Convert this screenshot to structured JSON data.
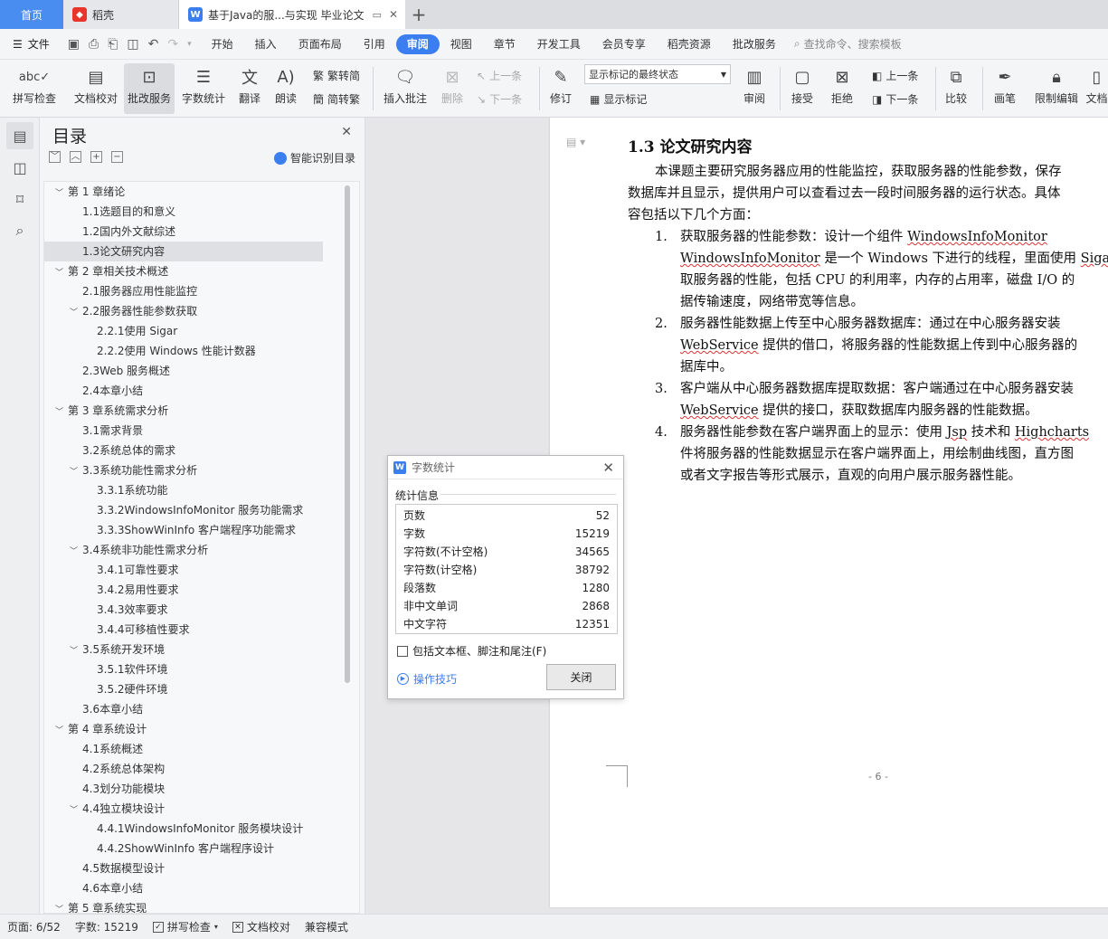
{
  "tabs": [
    {
      "label": "首页"
    },
    {
      "label": "稻壳"
    },
    {
      "label": "基于Java的服...与实现 毕业论文"
    }
  ],
  "menu": {
    "file": "文件",
    "items": [
      "开始",
      "插入",
      "页面布局",
      "引用",
      "审阅",
      "视图",
      "章节",
      "开发工具",
      "会员专享",
      "稻壳资源",
      "批改服务"
    ],
    "active_index": 4,
    "search": "查找命令、搜索模板"
  },
  "ribbon": {
    "spell": "拼写检查",
    "proof": "文档校对",
    "correct": "批改服务",
    "wordcount": "字数统计",
    "translate": "翻译",
    "read": "朗读",
    "trad": "繁转简",
    "simp": "简转繁",
    "insert_comment": "插入批注",
    "delete": "删除",
    "prev": "上一条",
    "next": "下一条",
    "revise": "修订",
    "markup_state": "显示标记的最终状态",
    "show_markup": "显示标记",
    "review": "审阅",
    "accept": "接受",
    "reject": "拒绝",
    "prev2": "上一条",
    "next2": "下一条",
    "compare": "比较",
    "pen": "画笔",
    "restrict": "限制编辑",
    "doc": "文档"
  },
  "toc": {
    "title": "目录",
    "smart": "智能识别目录",
    "items": [
      {
        "label": "第 1 章绪论",
        "level": 1,
        "arrow": "﹀"
      },
      {
        "label": "1.1选题目的和意义",
        "level": 2,
        "arrow": ""
      },
      {
        "label": "1.2国内外文献综述",
        "level": 2,
        "arrow": ""
      },
      {
        "label": "1.3论文研究内容",
        "level": 2,
        "arrow": "",
        "selected": true
      },
      {
        "label": "第 2 章相关技术概述",
        "level": 1,
        "arrow": "﹀"
      },
      {
        "label": "2.1服务器应用性能监控",
        "level": 2,
        "arrow": ""
      },
      {
        "label": "2.2服务器性能参数获取",
        "level": 2,
        "arrow": "﹀"
      },
      {
        "label": "2.2.1使用 Sigar",
        "level": 3,
        "arrow": ""
      },
      {
        "label": "2.2.2使用 Windows 性能计数器",
        "level": 3,
        "arrow": ""
      },
      {
        "label": "2.3Web 服务概述",
        "level": 2,
        "arrow": ""
      },
      {
        "label": "2.4本章小结",
        "level": 2,
        "arrow": ""
      },
      {
        "label": "第 3 章系统需求分析",
        "level": 1,
        "arrow": "﹀"
      },
      {
        "label": "3.1需求背景",
        "level": 2,
        "arrow": ""
      },
      {
        "label": "3.2系统总体的需求",
        "level": 2,
        "arrow": ""
      },
      {
        "label": "3.3系统功能性需求分析",
        "level": 2,
        "arrow": "﹀"
      },
      {
        "label": "3.3.1系统功能",
        "level": 3,
        "arrow": ""
      },
      {
        "label": "3.3.2WindowsInfoMonitor 服务功能需求",
        "level": 3,
        "arrow": ""
      },
      {
        "label": "3.3.3ShowWinInfo 客户端程序功能需求",
        "level": 3,
        "arrow": ""
      },
      {
        "label": "3.4系统非功能性需求分析",
        "level": 2,
        "arrow": "﹀"
      },
      {
        "label": "3.4.1可靠性要求",
        "level": 3,
        "arrow": ""
      },
      {
        "label": "3.4.2易用性要求",
        "level": 3,
        "arrow": ""
      },
      {
        "label": "3.4.3效率要求",
        "level": 3,
        "arrow": ""
      },
      {
        "label": "3.4.4可移植性要求",
        "level": 3,
        "arrow": ""
      },
      {
        "label": "3.5系统开发环境",
        "level": 2,
        "arrow": "﹀"
      },
      {
        "label": "3.5.1软件环境",
        "level": 3,
        "arrow": ""
      },
      {
        "label": "3.5.2硬件环境",
        "level": 3,
        "arrow": ""
      },
      {
        "label": "3.6本章小结",
        "level": 2,
        "arrow": ""
      },
      {
        "label": "第 4 章系统设计",
        "level": 1,
        "arrow": "﹀"
      },
      {
        "label": "4.1系统概述",
        "level": 2,
        "arrow": ""
      },
      {
        "label": "4.2系统总体架构",
        "level": 2,
        "arrow": ""
      },
      {
        "label": "4.3划分功能模块",
        "level": 2,
        "arrow": ""
      },
      {
        "label": "4.4独立模块设计",
        "level": 2,
        "arrow": "﹀"
      },
      {
        "label": "4.4.1WindowsInfoMonitor 服务模块设计",
        "level": 3,
        "arrow": ""
      },
      {
        "label": "4.4.2ShowWinInfo 客户端程序设计",
        "level": 3,
        "arrow": ""
      },
      {
        "label": "4.5数据模型设计",
        "level": 2,
        "arrow": ""
      },
      {
        "label": "4.6本章小结",
        "level": 2,
        "arrow": ""
      },
      {
        "label": "第 5 章系统实现",
        "level": 1,
        "arrow": "﹀"
      }
    ]
  },
  "doc": {
    "heading": "1.3  论文研究内容",
    "p1": [
      "本课题主要研究服务器应用的性能监控，获取服务器的性能参数，保存",
      "数据库并且显示，提供用户可以查看过去一段时间服务器的运行状态。具体",
      "容包括以下几个方面："
    ],
    "l1_num": "1.",
    "l1": [
      "获取服务器的性能参数：设计一个组件 ",
      "WindowsInfoMonitor",
      "是一个 Windows 下进行的线程，里面使用 ",
      "Sigar",
      "取服务器的性能，包括 CPU 的利用率，内存的占用率，磁盘 I/O 的",
      "据传输速度，网络带宽等信息。"
    ],
    "l2_num": "2.",
    "l2": [
      "服务器性能数据上传至中心服务器数据库：通过在中心服务器安装",
      "WebService",
      " 提供的借口，将服务器的性能数据上传到中心服务器的",
      "据库中。"
    ],
    "l3_num": "3.",
    "l3": [
      "客户端从中心服务器数据库提取数据：客户端通过在中心服务器安装",
      "WebService",
      " 提供的接口，获取数据库内服务器的性能数据。"
    ],
    "l4_num": "4.",
    "l4": [
      "服务器性能参数在客户端界面上的显示：使用 ",
      "Jsp",
      " 技术和 ",
      "Highcharts",
      "件将服务器的性能数据显示在客户端界面上，用绘制曲线图，直方图",
      "或者文字报告等形式展示，直观的向用户展示服务器性能。"
    ],
    "page_number": "- 6 -"
  },
  "dialog": {
    "title": "字数统计",
    "section": "统计信息",
    "rows": [
      {
        "label": "页数",
        "value": "52"
      },
      {
        "label": "字数",
        "value": "15219"
      },
      {
        "label": "字符数(不计空格)",
        "value": "34565"
      },
      {
        "label": "字符数(计空格)",
        "value": "38792"
      },
      {
        "label": "段落数",
        "value": "1280"
      },
      {
        "label": "非中文单词",
        "value": "2868"
      },
      {
        "label": "中文字符",
        "value": "12351"
      }
    ],
    "include": "包括文本框、脚注和尾注(F)",
    "tips": "操作技巧",
    "close": "关闭"
  },
  "status": {
    "page": "页面: 6/52",
    "words": "字数: 15219",
    "spell": "拼写检查",
    "proof": "文档校对",
    "compat": "兼容模式"
  },
  "colors": {
    "accent": "#3b7ef0",
    "home_tab": "#4a8df0"
  }
}
